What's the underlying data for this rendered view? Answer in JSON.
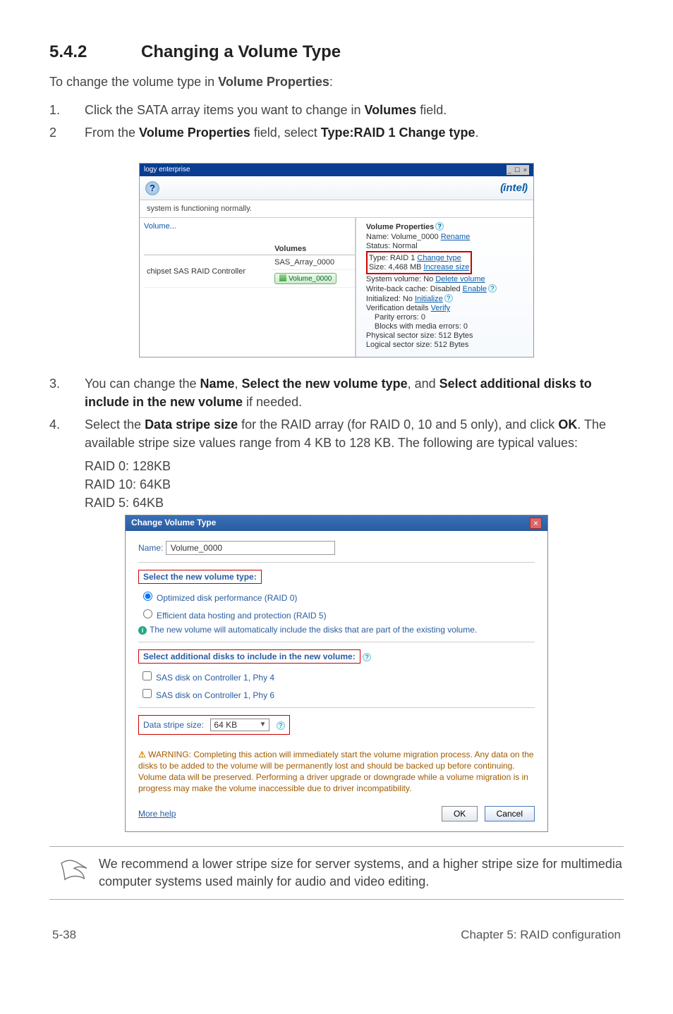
{
  "heading": {
    "num": "5.4.2",
    "title": "Changing a Volume Type"
  },
  "intro_pre": "To change the volume type in ",
  "intro_bold": "Volume Properties",
  "intro_post": ":",
  "steps": [
    {
      "n": "1.",
      "parts": [
        "Click the SATA array items you want to change in ",
        "Volumes",
        " field."
      ]
    },
    {
      "n": "2",
      "parts": [
        "From the ",
        "Volume Properties",
        " field, select ",
        "Type:RAID 1 Change type",
        "."
      ]
    }
  ],
  "steps2": [
    {
      "n": "3.",
      "parts": [
        "You can change the ",
        "Name",
        ", ",
        "Select the new volume type",
        ", and ",
        "Select additional disks to include in the new volume",
        " if needed."
      ]
    },
    {
      "n": "4.",
      "parts": [
        "Select the ",
        "Data stripe size",
        " for the RAID array (for RAID 0, 10 and 5 only), and click ",
        "OK",
        ". The available stripe size values range from 4 KB to 128 KB. The following are typical values:"
      ]
    }
  ],
  "sublines": [
    "RAID 0: 128KB",
    "RAID 10: 64KB",
    "RAID 5: 64KB"
  ],
  "fig1": {
    "titlebar": "logy enterprise",
    "winbtns": "_ ☐ ×",
    "intel": "intel",
    "status": "system is functioning normally.",
    "left": {
      "volume_link": "Volume...",
      "col_volumes": "Volumes",
      "ctrl": "chipset SAS RAID Controller",
      "arr": "SAS_Array_0000",
      "volbtn": "Volume_0000"
    },
    "right": {
      "hdr": "Volume Properties",
      "name_lbl": "Name: Volume_0000 ",
      "rename": "Rename",
      "status_line": "Status: Normal",
      "type_lbl": "Type: RAID 1 ",
      "change_type": "Change type",
      "size_lbl": "Size: 4,468 MB ",
      "inc_size": "Increase size",
      "sysvol_lbl": "System volume: No ",
      "del_vol": "Delete volume",
      "wb_lbl": "Write-back cache: Disabled ",
      "enable": "Enable",
      "init_lbl": "Initialized: No ",
      "initialize": "Initialize",
      "verif_lbl": "Verification details ",
      "verify": "Verify",
      "parity": "Parity errors: 0",
      "blocks": "Blocks with media errors: 0",
      "phys": "Physical sector size: 512 Bytes",
      "log": "Logical sector size: 512 Bytes"
    }
  },
  "fig2": {
    "title": "Change Volume Type",
    "close": "×",
    "name_lbl": "Name:",
    "name_val": "Volume_0000",
    "sub1": "Select the new volume type:",
    "opt1": "Optimized disk performance (RAID 0)",
    "opt2": "Efficient data hosting and protection (RAID 5)",
    "info1": "The new volume will automatically include the disks that are part of the existing volume.",
    "sub2": "Select additional disks to include in the new volume:",
    "disk1": "SAS disk on Controller 1, Phy 4",
    "disk2": "SAS disk on Controller 1, Phy 6",
    "ds_lbl": "Data stripe size:",
    "ds_val": "64 KB",
    "warn": "WARNING: Completing this action will immediately start the volume migration process. Any data on the disks to be added to the volume will be permanently lost and should be backed up before continuing. Volume data will be preserved. Performing a driver upgrade or downgrade while a volume migration is in progress may make the volume inaccessible due to driver incompatibility.",
    "more": "More help",
    "ok": "OK",
    "cancel": "Cancel"
  },
  "note": "We recommend a lower stripe size for server systems, and a higher stripe size for multimedia computer systems used mainly for audio and video editing.",
  "footer": {
    "left": "5-38",
    "right": "Chapter 5: RAID configuration"
  }
}
